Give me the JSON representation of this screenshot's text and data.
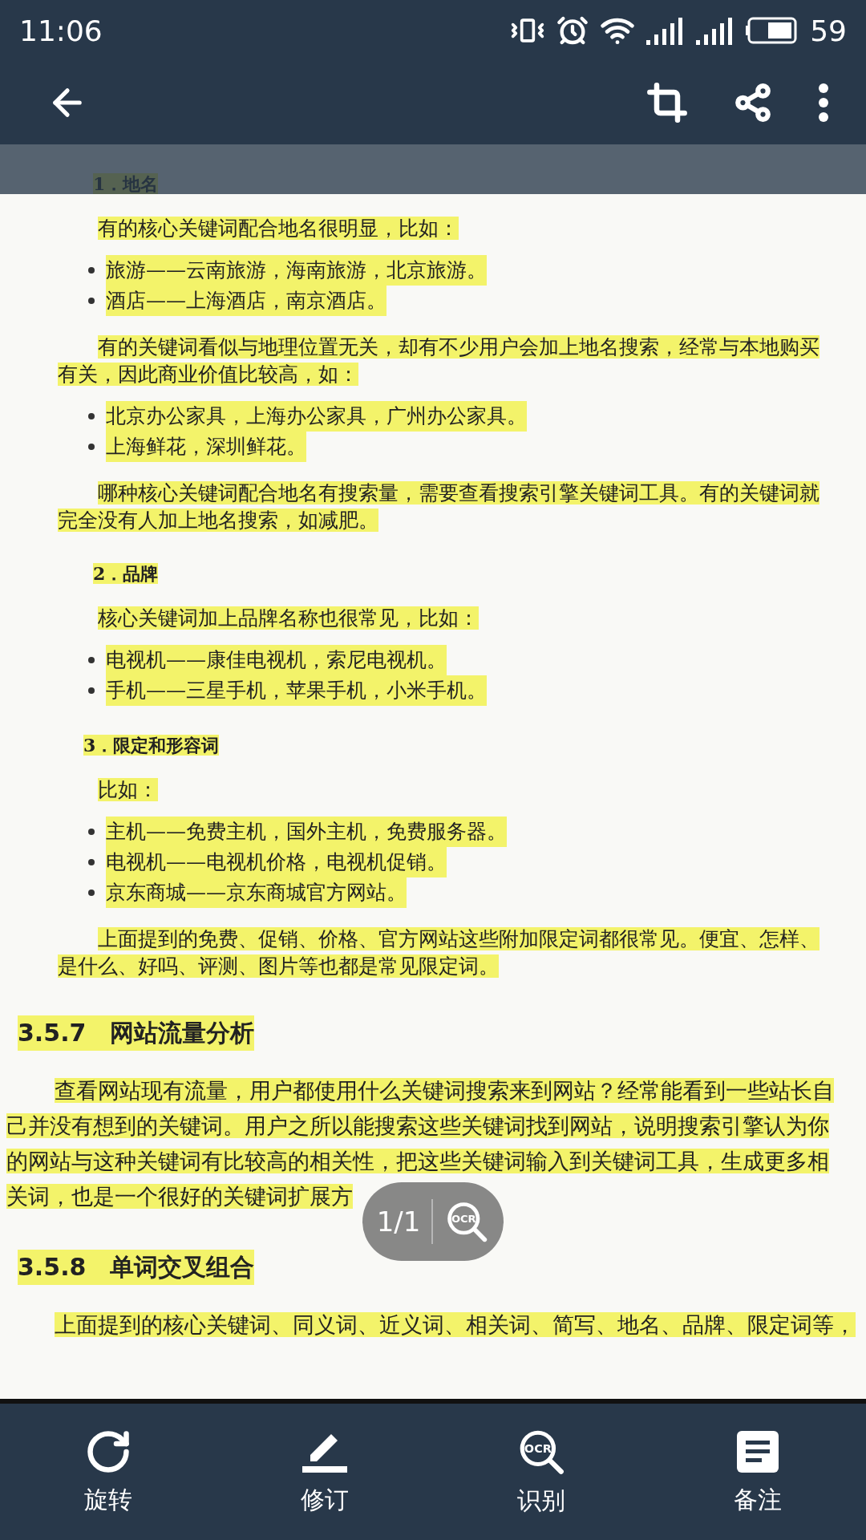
{
  "status_bar": {
    "time": "11:06",
    "battery_percent": "59"
  },
  "document": {
    "blocks": [
      {
        "kind": "label",
        "text": "1．地名"
      },
      {
        "kind": "paragraph",
        "lines": [
          "有的核心关键词配合地名很明显，比如："
        ]
      },
      {
        "kind": "list",
        "items": [
          "旅游——云南旅游，海南旅游，北京旅游。",
          "酒店——上海酒店，南京酒店。"
        ]
      },
      {
        "kind": "paragraph",
        "lines": [
          "有的关键词看似与地理位置无关，却有不少用户会加上地名搜索，经常与本地购买",
          "有关，因此商业价值比较高，如："
        ]
      },
      {
        "kind": "list",
        "items": [
          "北京办公家具，上海办公家具，广州办公家具。",
          "上海鲜花，深圳鲜花。"
        ]
      },
      {
        "kind": "paragraph",
        "lines": [
          "哪种核心关键词配合地名有搜索量，需要查看搜索引擎关键词工具。有的关键词就",
          "完全没有人加上地名搜索，如减肥。"
        ]
      },
      {
        "kind": "label",
        "text": "2．品牌"
      },
      {
        "kind": "paragraph",
        "lines": [
          "核心关键词加上品牌名称也很常见，比如："
        ]
      },
      {
        "kind": "list",
        "items": [
          "电视机——康佳电视机，索尼电视机。",
          "手机——三星手机，苹果手机，小米手机。"
        ]
      },
      {
        "kind": "label",
        "text": "3．限定和形容词"
      },
      {
        "kind": "paragraph",
        "lines": [
          "比如："
        ]
      },
      {
        "kind": "list",
        "items": [
          "主机——免费主机，国外主机，免费服务器。",
          "电视机——电视机价格，电视机促销。",
          "京东商城——京东商城官方网站。"
        ]
      },
      {
        "kind": "paragraph",
        "lines": [
          "上面提到的免费、促销、价格、官方网站这些附加限定词都很常见。便宜、怎样、",
          "是什么、好吗、评测、图片等也都是常见限定词。"
        ]
      },
      {
        "kind": "heading",
        "text": "3.5.7　网站流量分析"
      },
      {
        "kind": "body",
        "lines": [
          "查看网站现有流量，用户都使用什么关键词搜索来到网站？经常能看到一些站长自",
          "己并没有想到的关键词。用户之所以能搜索这些关键词找到网站，说明搜索引擎认为你",
          "的网站与这种关键词有比较高的相关性，把这些关键词输入到关键词工具，生成更多相",
          "关词，也是一个很好的关键词扩展方"
        ]
      },
      {
        "kind": "heading",
        "text": "3.5.8　单词交叉组合"
      },
      {
        "kind": "body",
        "lines": [
          "上面提到的核心关键词、同义词、近义词、相关词、简写、地名、品牌、限定词等，"
        ]
      }
    ]
  },
  "page_pill": {
    "counter": "1/1",
    "ocr_badge": "OCR"
  },
  "bottom_nav": [
    {
      "kind": "rotate",
      "label": "旋转"
    },
    {
      "kind": "revise",
      "label": "修订"
    },
    {
      "kind": "ocr",
      "label": "识别",
      "badge": "OCR"
    },
    {
      "kind": "note",
      "label": "备注"
    }
  ]
}
